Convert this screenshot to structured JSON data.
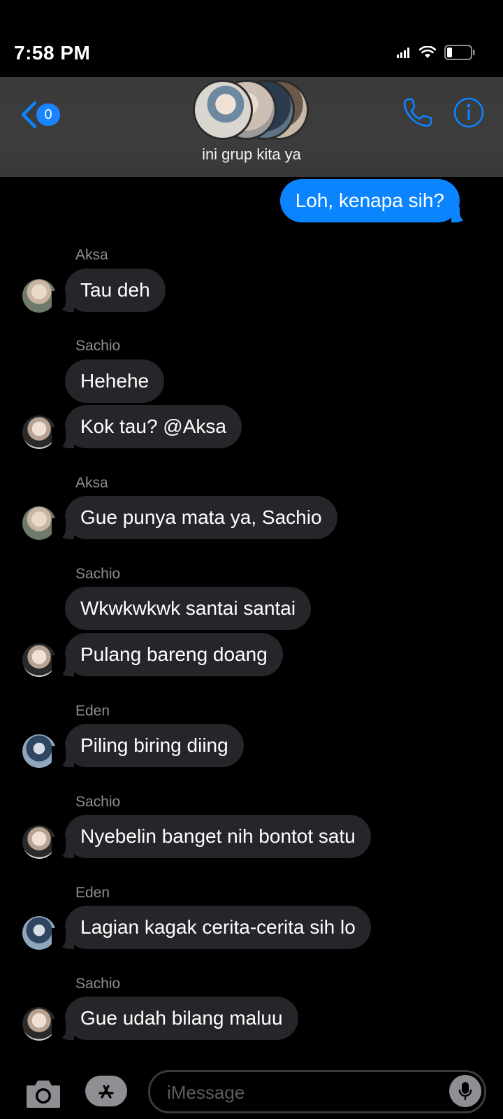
{
  "status_bar": {
    "time": "7:58 PM",
    "icons": [
      "cellular-signal-icon",
      "wifi-icon",
      "battery-icon"
    ]
  },
  "header": {
    "back_badge": "0",
    "group_name": "ini grup kita ya",
    "icons": [
      "back-chevron-icon",
      "phone-icon",
      "info-icon"
    ],
    "accent_color": "#0a84ff"
  },
  "messages": [
    {
      "type": "outgoing",
      "text": "Loh, kenapa sih?"
    },
    {
      "type": "sender",
      "text": "Aksa"
    },
    {
      "type": "incoming",
      "text": "Tau deh"
    },
    {
      "type": "sender",
      "text": "Sachio"
    },
    {
      "type": "incoming",
      "text": "Hehehe"
    },
    {
      "type": "incoming",
      "text": "Kok tau? @Aksa"
    },
    {
      "type": "sender",
      "text": "Aksa"
    },
    {
      "type": "incoming",
      "text": "Gue punya mata ya, Sachio"
    },
    {
      "type": "sender",
      "text": "Sachio"
    },
    {
      "type": "incoming",
      "text": "Wkwkwkwk santai santai"
    },
    {
      "type": "incoming",
      "text": "Pulang bareng doang"
    },
    {
      "type": "sender",
      "text": "Eden"
    },
    {
      "type": "incoming",
      "text": "Piling biring diing"
    },
    {
      "type": "sender",
      "text": "Sachio"
    },
    {
      "type": "incoming",
      "text": "Nyebelin banget nih bontot satu"
    },
    {
      "type": "sender",
      "text": "Eden"
    },
    {
      "type": "incoming",
      "text": "Lagian kagak cerita-cerita sih lo"
    },
    {
      "type": "sender",
      "text": "Sachio"
    },
    {
      "type": "incoming",
      "text": "Gue udah bilang maluu"
    }
  ],
  "input_bar": {
    "placeholder": "iMessage",
    "icons": [
      "camera-icon",
      "app-store-icon",
      "microphone-icon"
    ]
  },
  "colors": {
    "background": "#000000",
    "incoming_bubble": "#26252a",
    "outgoing_bubble": "#0a84ff",
    "sender_name": "#8e8e93"
  }
}
